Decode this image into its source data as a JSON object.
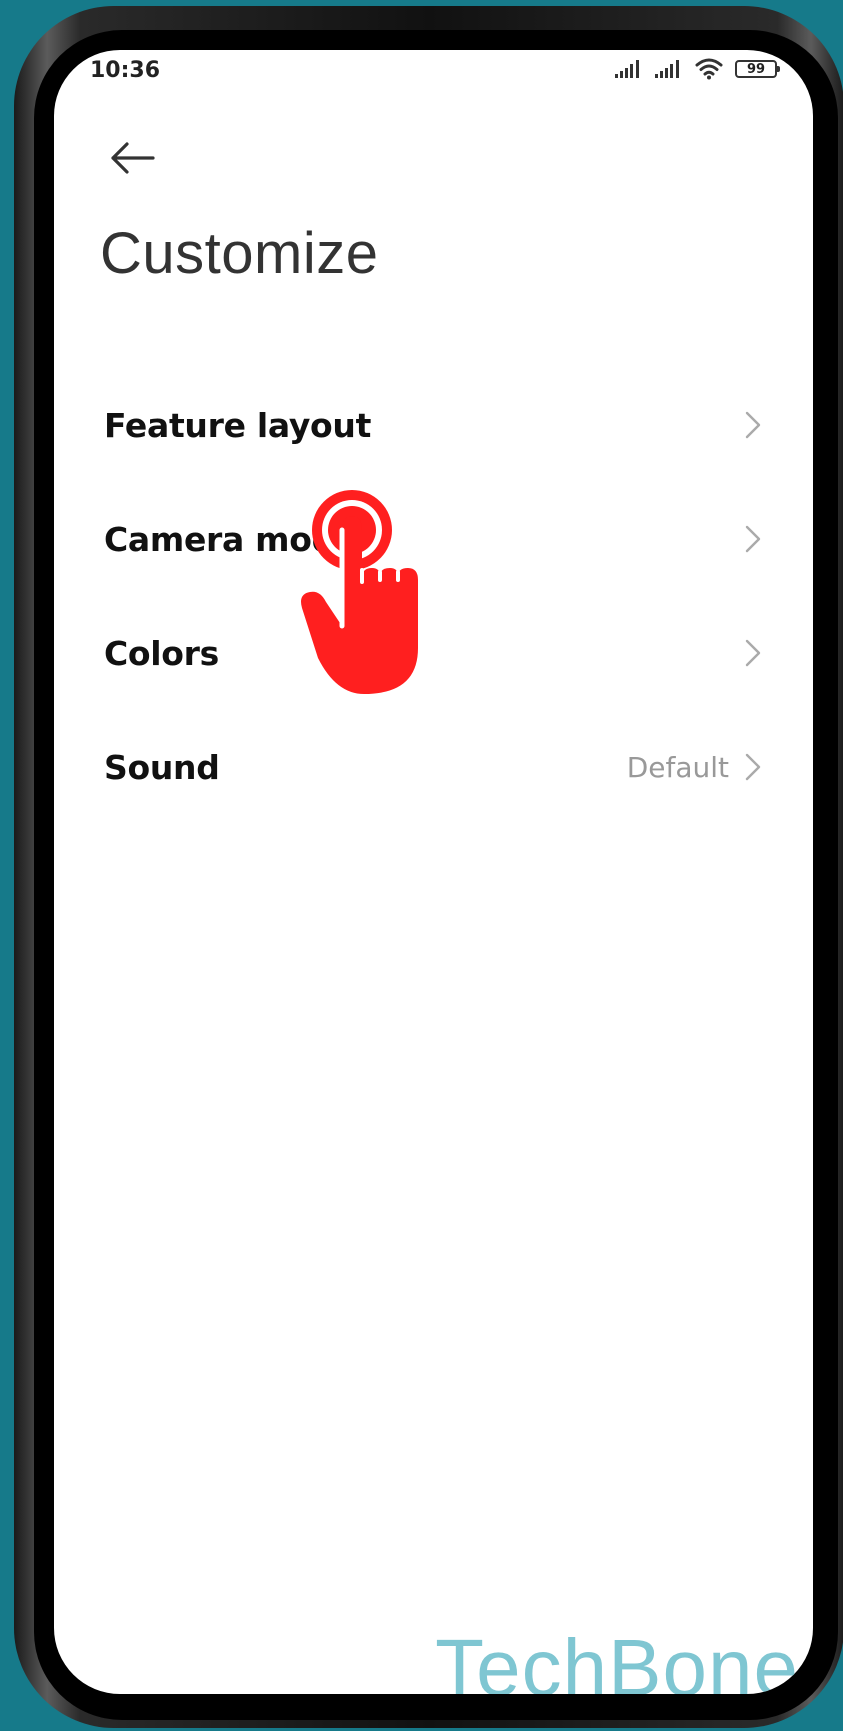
{
  "status_bar": {
    "time": "10:36",
    "battery": "99"
  },
  "header": {
    "back_icon": "arrow-left-icon",
    "title": "Customize"
  },
  "settings": [
    {
      "label": "Feature layout",
      "value": ""
    },
    {
      "label": "Camera modes",
      "value": ""
    },
    {
      "label": "Colors",
      "value": ""
    },
    {
      "label": "Sound",
      "value": "Default"
    }
  ],
  "watermark": "TechBone",
  "colors": {
    "background": "#167a8a",
    "tap_hand": "#ff1f1f",
    "watermark": "#7fc6d2"
  }
}
